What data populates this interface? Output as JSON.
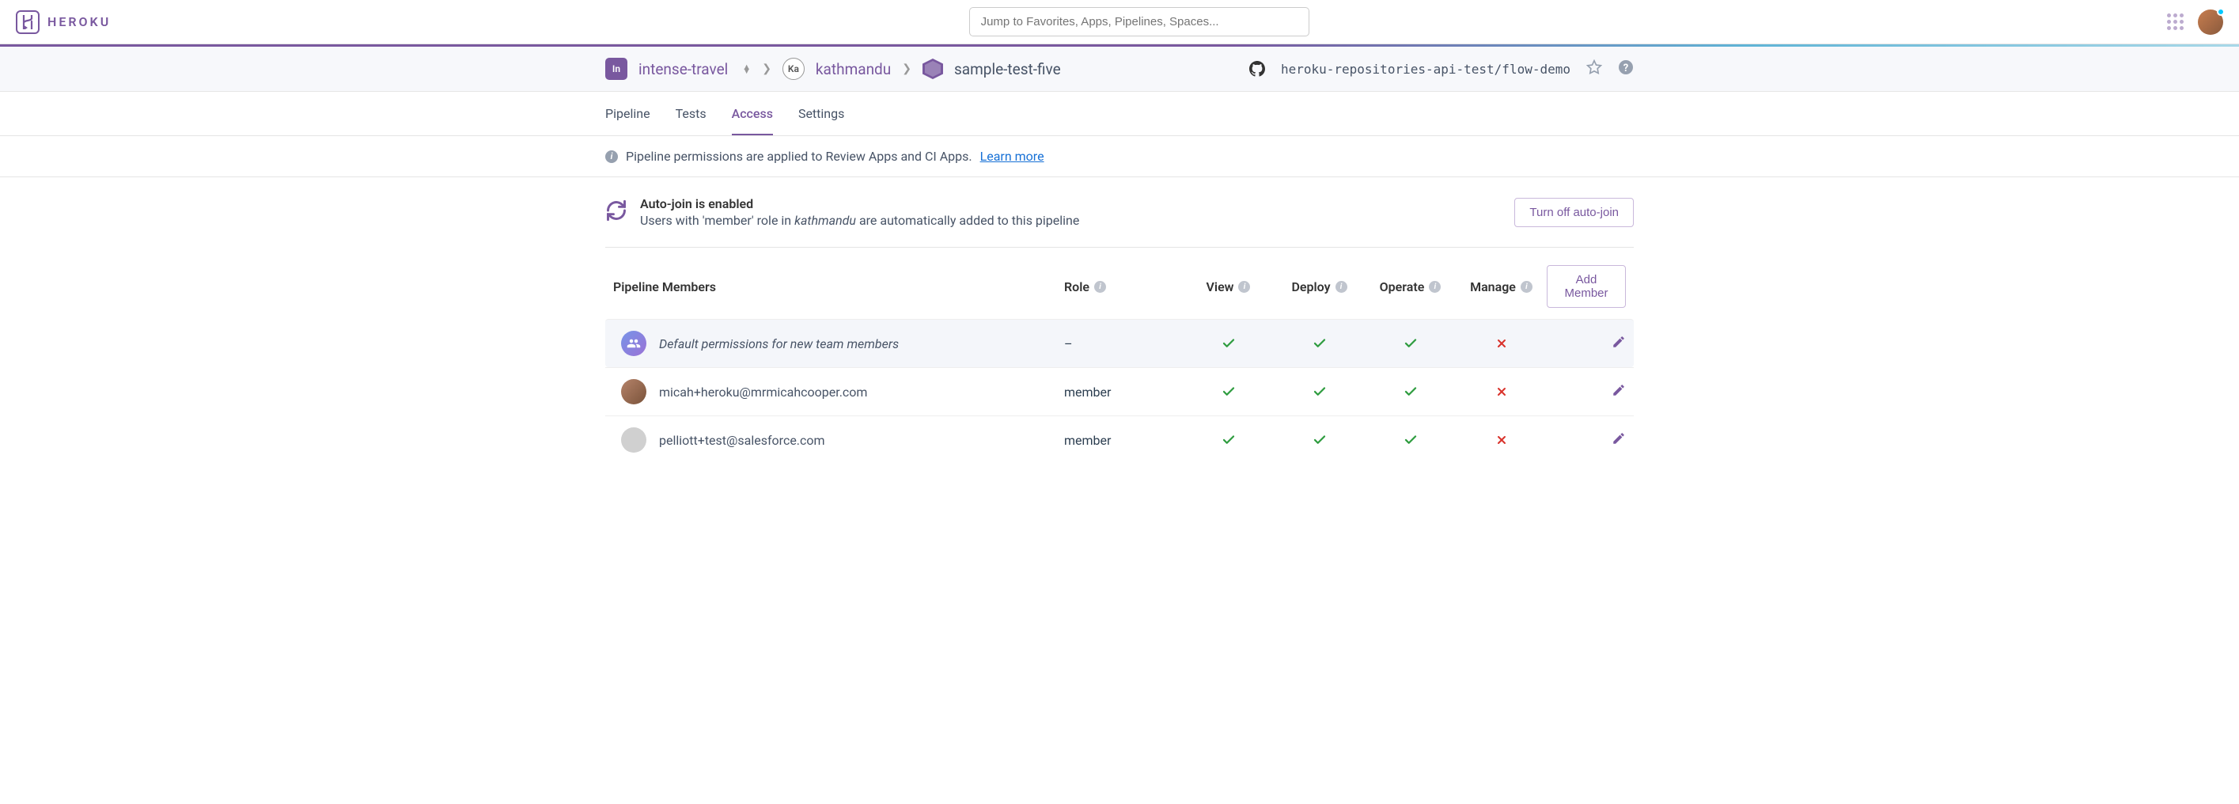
{
  "brand": "HEROKU",
  "search": {
    "placeholder": "Jump to Favorites, Apps, Pipelines, Spaces..."
  },
  "breadcrumb": {
    "team_badge": "In",
    "team": "intense-travel",
    "space_badge": "Ka",
    "space": "kathmandu",
    "app": "sample-test-five"
  },
  "repo": "heroku-repositories-api-test/flow-demo",
  "tabs": [
    "Pipeline",
    "Tests",
    "Access",
    "Settings"
  ],
  "active_tab": "Access",
  "info_text": "Pipeline permissions are applied to Review Apps and CI Apps.",
  "info_link": "Learn more",
  "autojoin": {
    "title": "Auto-join is enabled",
    "sub_prefix": "Users with 'member' role in ",
    "sub_em": "kathmandu",
    "sub_suffix": " are automatically added to this pipeline",
    "button": "Turn off auto-join"
  },
  "columns": {
    "member": "Pipeline Members",
    "role": "Role",
    "view": "View",
    "deploy": "Deploy",
    "operate": "Operate",
    "manage": "Manage"
  },
  "add_member_button": "Add Member",
  "rows": [
    {
      "type": "default",
      "name": "Default permissions for new team members",
      "role": "–",
      "view": true,
      "deploy": true,
      "operate": true,
      "manage": false
    },
    {
      "type": "user",
      "name": "micah+heroku@mrmicahcooper.com",
      "role": "member",
      "view": true,
      "deploy": true,
      "operate": true,
      "manage": false,
      "avatar": "real"
    },
    {
      "type": "user",
      "name": "pelliott+test@salesforce.com",
      "role": "member",
      "view": true,
      "deploy": true,
      "operate": true,
      "manage": false,
      "avatar": "placeholder"
    }
  ]
}
